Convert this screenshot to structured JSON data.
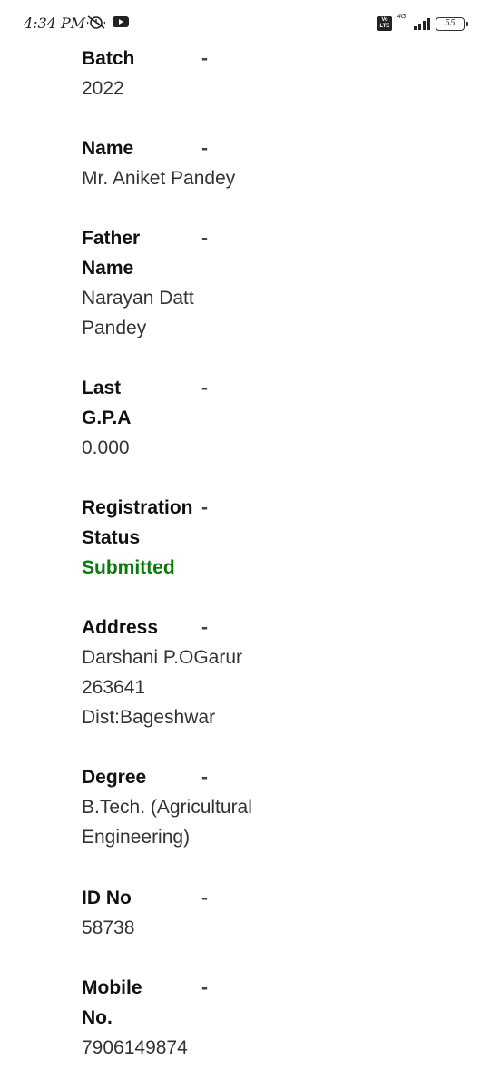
{
  "status_bar": {
    "time": "4:34 PM",
    "network": "4G",
    "battery": "55",
    "icons": [
      "alarm-icon",
      "youtube-icon",
      "volte-icon",
      "signal-icon",
      "battery-icon"
    ]
  },
  "fields": [
    {
      "label": "Batch",
      "separator": "-",
      "value": "2022"
    },
    {
      "label": "Name",
      "separator": "-",
      "value": "Mr. Aniket Pandey"
    },
    {
      "label": "Father Name",
      "separator": "-",
      "value": "Narayan Datt Pandey"
    },
    {
      "label": "Last G.P.A",
      "separator": "-",
      "value": "0.000"
    },
    {
      "label": "Registration Status",
      "separator": "-",
      "value": "Submitted"
    },
    {
      "label": "Address",
      "separator": "-",
      "value": "Darshani P.OGarur 263641 Dist:Bageshwar"
    },
    {
      "label": "Degree",
      "separator": "-",
      "value": "B.Tech. (Agricultural Engineering)"
    },
    {
      "label": "ID No",
      "separator": "-",
      "value": "58738"
    },
    {
      "label": "Mobile No.",
      "separator": "-",
      "value": "7906149874"
    }
  ],
  "colors": {
    "status_submitted": "#0a7a0a",
    "divider": "#dddddd"
  }
}
